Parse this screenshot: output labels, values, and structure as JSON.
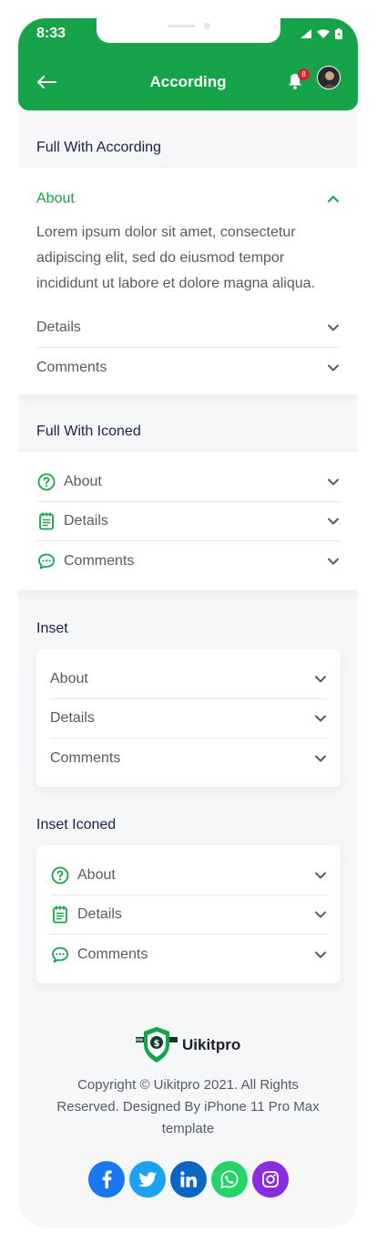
{
  "status": {
    "time": "8:33"
  },
  "header": {
    "title": "According",
    "notification_count": "8"
  },
  "sections": {
    "full_according": {
      "title": "Full With According",
      "open_item": {
        "label": "About",
        "body": "Lorem ipsum dolor sit amet, consectetur adipiscing elit, sed do eiusmod tempor incididunt ut labore et dolore magna aliqua."
      },
      "items": [
        "Details",
        "Comments"
      ]
    },
    "full_iconed": {
      "title": "Full With Iconed",
      "items": [
        {
          "label": "About",
          "icon": "question-circle-icon"
        },
        {
          "label": "Details",
          "icon": "document-icon"
        },
        {
          "label": "Comments",
          "icon": "chat-icon"
        }
      ]
    },
    "inset": {
      "title": "Inset",
      "items": [
        "About",
        "Details",
        "Comments"
      ]
    },
    "inset_iconed": {
      "title": "Inset Iconed",
      "items": [
        {
          "label": "About",
          "icon": "question-circle-icon"
        },
        {
          "label": "Details",
          "icon": "document-icon"
        },
        {
          "label": "Comments",
          "icon": "chat-icon"
        }
      ]
    }
  },
  "footer": {
    "brand": "Uikitpro",
    "copyright": "Copyright © Uikitpro 2021. All Rights Reserved. Designed By iPhone 11 Pro Max template",
    "socials": [
      {
        "name": "facebook",
        "glyph": "f",
        "color": "#1877f2"
      },
      {
        "name": "twitter",
        "glyph": "t",
        "color": "#1da1f2"
      },
      {
        "name": "linkedin",
        "glyph": "in",
        "color": "#0a66c2"
      },
      {
        "name": "whatsapp",
        "glyph": "w",
        "color": "#25d366"
      },
      {
        "name": "instagram",
        "glyph": "ig",
        "color": "#8a2be2"
      }
    ]
  },
  "colors": {
    "accent": "#16a34a",
    "heading": "#1b1f4a",
    "text": "#555b66",
    "badge": "#e11d2a"
  }
}
